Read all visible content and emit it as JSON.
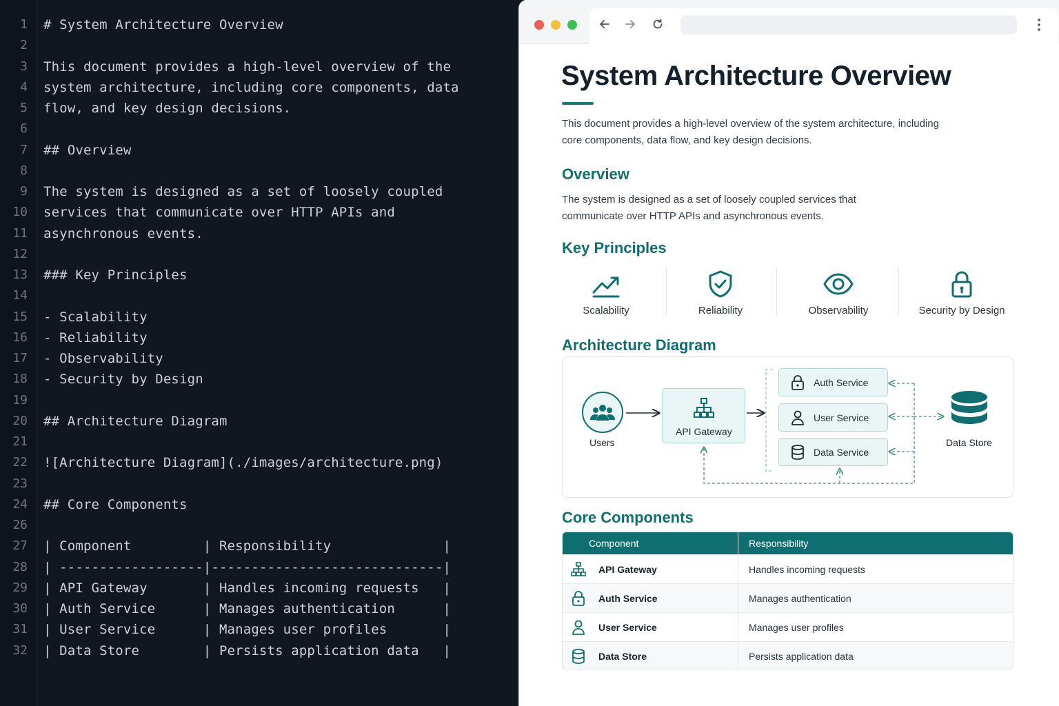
{
  "editor": {
    "lines": [
      "# System Architecture Overview",
      "",
      "This document provides a high-level overview of the",
      "system architecture, including core components, data",
      "flow, and key design decisions.",
      "",
      "## Overview",
      "",
      "The system is designed as a set of loosely coupled",
      "services that communicate over HTTP APIs and",
      "asynchronous events.",
      "",
      "### Key Principles",
      "",
      "- Scalability",
      "- Reliability",
      "- Observability",
      "- Security by Design",
      "",
      "## Architecture Diagram",
      "",
      "![Architecture Diagram](./images/architecture.png)",
      "",
      "## Core Components",
      "",
      "| Component         | Responsibility              |",
      "| ------------------|-----------------------------|",
      "| API Gateway       | Handles incoming requests   |",
      "| Auth Service      | Manages authentication      |",
      "| User Service      | Manages user profiles       |",
      "| Data Store        | Persists application data   |"
    ],
    "line_numbers": [
      "1",
      "2",
      "3",
      "4",
      "5",
      "6",
      "7",
      "8",
      "9",
      "10",
      "11",
      "12",
      "13",
      "14",
      "15",
      "16",
      "17",
      "18",
      "19",
      "20",
      "21",
      "22",
      "23",
      "24",
      "26",
      "27",
      "28",
      "29",
      "30",
      "31",
      "32"
    ]
  },
  "browser": {
    "colors": {
      "accent": "#0f6f70",
      "red": "#ec5f57",
      "yellow": "#f4be3e",
      "green": "#39c153"
    }
  },
  "doc": {
    "title": "System Architecture Overview",
    "intro": "This document provides a high-level overview of the system architecture, including core components, data flow, and key design decisions.",
    "overview_heading": "Overview",
    "overview_text": "The system is designed as a set of loosely coupled services that communicate over HTTP APIs and asynchronous events.",
    "principles_heading": "Key Principles",
    "principles": [
      {
        "label": "Scalability",
        "icon": "trending-up-icon"
      },
      {
        "label": "Reliability",
        "icon": "shield-check-icon"
      },
      {
        "label": "Observability",
        "icon": "eye-icon"
      },
      {
        "label": "Security by Design",
        "icon": "lock-icon"
      }
    ],
    "diagram_heading": "Architecture Diagram",
    "diagram": {
      "users": "Users",
      "gateway": "API Gateway",
      "auth": "Auth Service",
      "user": "User Service",
      "data_service": "Data Service",
      "store": "Data Store"
    },
    "components_heading": "Core Components",
    "table": {
      "headers": [
        "Component",
        "Responsibility"
      ],
      "rows": [
        {
          "component": "API Gateway",
          "responsibility": "Handles incoming requests",
          "icon": "network-icon"
        },
        {
          "component": "Auth Service",
          "responsibility": "Manages authentication",
          "icon": "lock-icon"
        },
        {
          "component": "User Service",
          "responsibility": "Manages user profiles",
          "icon": "user-icon"
        },
        {
          "component": "Data Store",
          "responsibility": "Persists application data",
          "icon": "database-icon"
        }
      ]
    }
  }
}
